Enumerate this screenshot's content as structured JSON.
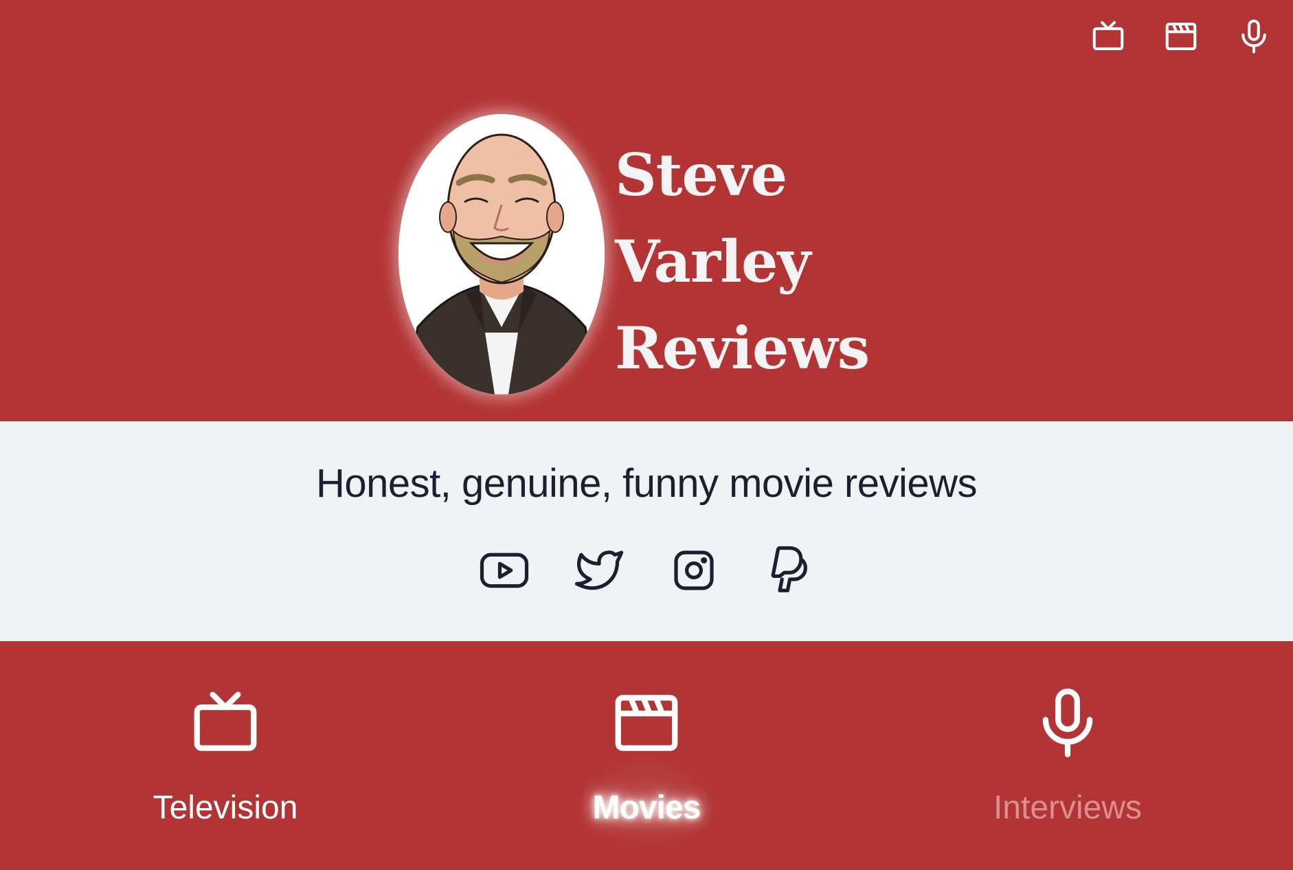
{
  "header": {
    "nav_icons": [
      {
        "name": "television-icon"
      },
      {
        "name": "clapperboard-icon"
      },
      {
        "name": "microphone-icon"
      }
    ],
    "brand_lines": [
      "Steve",
      "Varley",
      "Reviews"
    ]
  },
  "intro": {
    "tagline": "Honest, genuine, funny movie reviews",
    "socials": [
      {
        "name": "youtube-icon"
      },
      {
        "name": "twitter-icon"
      },
      {
        "name": "instagram-icon"
      },
      {
        "name": "paypal-icon"
      }
    ]
  },
  "bottom_nav": {
    "items": [
      {
        "label": "Television",
        "icon": "television-icon",
        "state": "default"
      },
      {
        "label": "Movies",
        "icon": "clapperboard-icon",
        "state": "active"
      },
      {
        "label": "Interviews",
        "icon": "microphone-icon",
        "state": "dimmed"
      }
    ]
  },
  "colors": {
    "primary_red": "#b33435",
    "band_background": "#f0f2f5",
    "text_dark": "#1f1d30",
    "brand_text": "#f3f3f4",
    "dimmed_label": "#dc8f90"
  }
}
